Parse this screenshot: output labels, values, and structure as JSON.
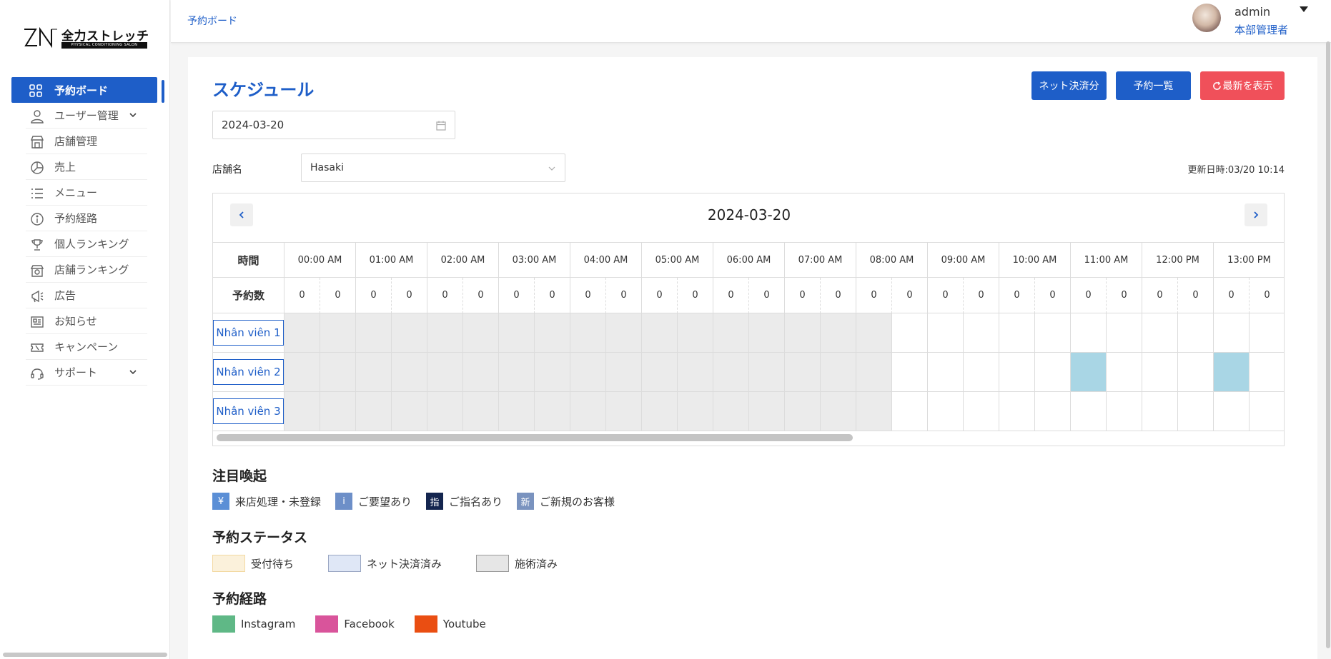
{
  "sidebar": {
    "brand_name": "全力ストレッチ",
    "brand_sub": "PHYSICAL CONDITIONING SALON",
    "items": [
      {
        "label": "予約ボード"
      },
      {
        "label": "ユーザー管理"
      },
      {
        "label": "店舗管理"
      },
      {
        "label": "売上"
      },
      {
        "label": "メニュー"
      },
      {
        "label": "予約経路"
      },
      {
        "label": "個人ランキング"
      },
      {
        "label": "店舗ランキング"
      },
      {
        "label": "広告"
      },
      {
        "label": "お知らせ"
      },
      {
        "label": "キャンペーン"
      },
      {
        "label": "サポート"
      }
    ]
  },
  "topbar": {
    "breadcrumb": "予約ボード",
    "user_name": "admin",
    "user_role": "本部管理者"
  },
  "main": {
    "title": "スケジュール",
    "buttons": {
      "net_paid": "ネット決済分",
      "reservation_list": "予約一覧",
      "refresh": "最新を表示"
    },
    "date_value": "2024-03-20",
    "shop_label": "店舗名",
    "shop_value": "Hasaki",
    "updated_at": "更新日時:03/20 10:14"
  },
  "schedule": {
    "date": "2024-03-20",
    "time_header": "時間",
    "count_header": "予約数",
    "hours": [
      "00:00 AM",
      "01:00 AM",
      "02:00 AM",
      "03:00 AM",
      "04:00 AM",
      "05:00 AM",
      "06:00 AM",
      "07:00 AM",
      "08:00 AM",
      "09:00 AM",
      "10:00 AM",
      "11:00 AM",
      "12:00 PM",
      "13:00 PM"
    ],
    "counts": [
      "0",
      "0",
      "0",
      "0",
      "0",
      "0",
      "0",
      "0",
      "0",
      "0",
      "0",
      "0",
      "0",
      "0",
      "0",
      "0",
      "0",
      "0",
      "0",
      "0",
      "0",
      "0",
      "0",
      "0",
      "0",
      "0",
      "0",
      "0"
    ],
    "staff": [
      {
        "name": "Nhân viên 1",
        "booked_slots": []
      },
      {
        "name": "Nhân viên 2",
        "booked_slots": [
          22,
          26
        ]
      },
      {
        "name": "Nhân viên 3",
        "booked_slots": []
      }
    ],
    "closed_until_slot": 17
  },
  "legends": {
    "attention_title": "注目喚起",
    "attention_items": [
      {
        "icon": "¥",
        "label": "来店処理・未登録",
        "color": "#5b8fd6"
      },
      {
        "icon": "i",
        "label": "ご要望あり",
        "color": "#6d8fc8"
      },
      {
        "icon": "指",
        "label": "ご指名あり",
        "color": "#14254f"
      },
      {
        "icon": "新",
        "label": "ご新規のお客様",
        "color": "#7a93bf"
      }
    ],
    "status_title": "予約ステータス",
    "status_items": [
      {
        "label": "受付待ち",
        "color": "#fbf1db",
        "border": "#f3d9a1"
      },
      {
        "label": "ネット決済済み",
        "color": "#dfe7f6",
        "border": "#9aa7c3"
      },
      {
        "label": "施術済み",
        "color": "#e6e6e6",
        "border": "#9a9a9a"
      }
    ],
    "route_title": "予約経路",
    "route_items": [
      {
        "label": "Instagram",
        "color": "#5fb886"
      },
      {
        "label": "Facebook",
        "color": "#d9549b"
      },
      {
        "label": "Youtube",
        "color": "#ea4e12"
      }
    ]
  }
}
